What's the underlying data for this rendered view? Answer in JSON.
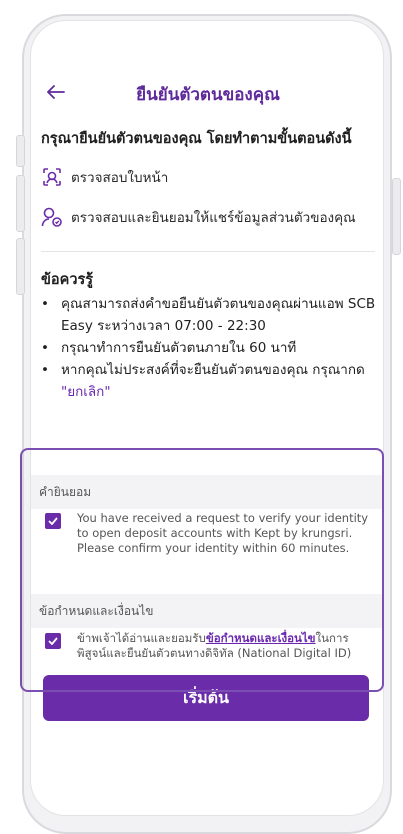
{
  "header": {
    "title": "ยืนยันตัวตนของคุณ"
  },
  "intro": "กรุณายืนยันตัวตนของคุณ โดยทำตามขั้นตอนดังนี้",
  "steps": [
    {
      "icon": "face-scan-icon",
      "label": "ตรวจสอบใบหน้า"
    },
    {
      "icon": "user-consent-icon",
      "label": "ตรวจสอบและยินยอมให้แชร์ข้อมูลส่วนตัวของคุณ"
    }
  ],
  "know": {
    "title": "ข้อควรรู้",
    "items": [
      "คุณสามารถส่งคำขอยืนยันตัวตนของคุณผ่านแอพ SCB Easy ระหว่างเวลา 07:00 - 22:30",
      "กรุณาทำการยืนยันตัวตนภายใน 60 นาที",
      "หากคุณไม่ประสงค์ที่จะยืนยันตัวตนของคุณ กรุณากด"
    ],
    "cancel_link": "\"ยกเลิก\""
  },
  "consent": {
    "header": "คำยินยอม",
    "text": "You have received a request to verify your identity to open deposit accounts with Kept by krungsri. Please confirm your identity within 60 minutes."
  },
  "terms": {
    "header": "ข้อกำหนดและเงื่อนไข",
    "text_before": "ข้าพเจ้าได้อ่านและยอมรับ",
    "link": "ข้อกำหนดและเงื่อนไข",
    "text_after": "ในการพิสูจน์และยืนยันตัวตนทางดิจิทัล (National Digital ID)"
  },
  "start_button": "เริ่มต้น",
  "colors": {
    "accent": "#6a2ca8",
    "title": "#5f2a9b"
  }
}
